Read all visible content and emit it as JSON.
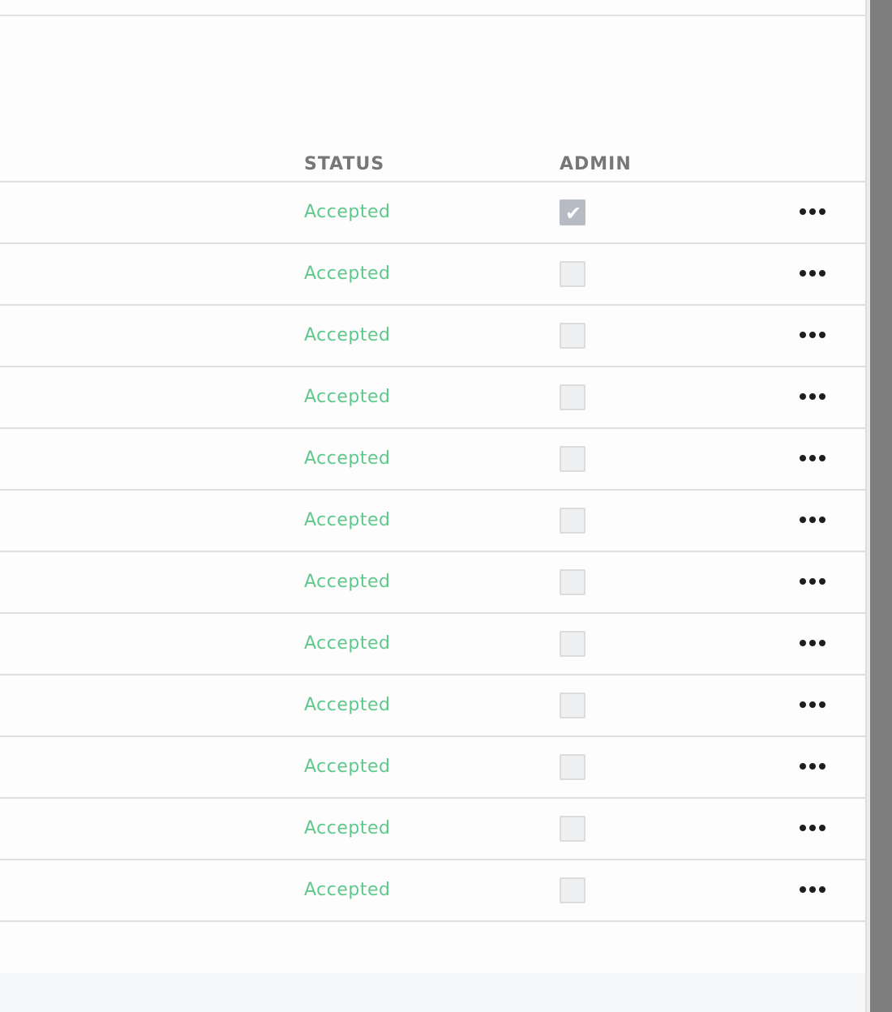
{
  "table": {
    "headers": {
      "status": "STATUS",
      "admin": "ADMIN"
    },
    "rows": [
      {
        "status": "Accepted",
        "admin": true
      },
      {
        "status": "Accepted",
        "admin": false
      },
      {
        "status": "Accepted",
        "admin": false
      },
      {
        "status": "Accepted",
        "admin": false
      },
      {
        "status": "Accepted",
        "admin": false
      },
      {
        "status": "Accepted",
        "admin": false
      },
      {
        "status": "Accepted",
        "admin": false
      },
      {
        "status": "Accepted",
        "admin": false
      },
      {
        "status": "Accepted",
        "admin": false
      },
      {
        "status": "Accepted",
        "admin": false
      },
      {
        "status": "Accepted",
        "admin": false
      },
      {
        "status": "Accepted",
        "admin": false
      }
    ]
  },
  "icons": {
    "row_menu": "more-options-icon",
    "checkmark": "checkmark-icon"
  },
  "colors": {
    "status_accepted": "#5ec98a",
    "header_text": "#777777",
    "checkbox_checked": "#b6bbc4"
  }
}
